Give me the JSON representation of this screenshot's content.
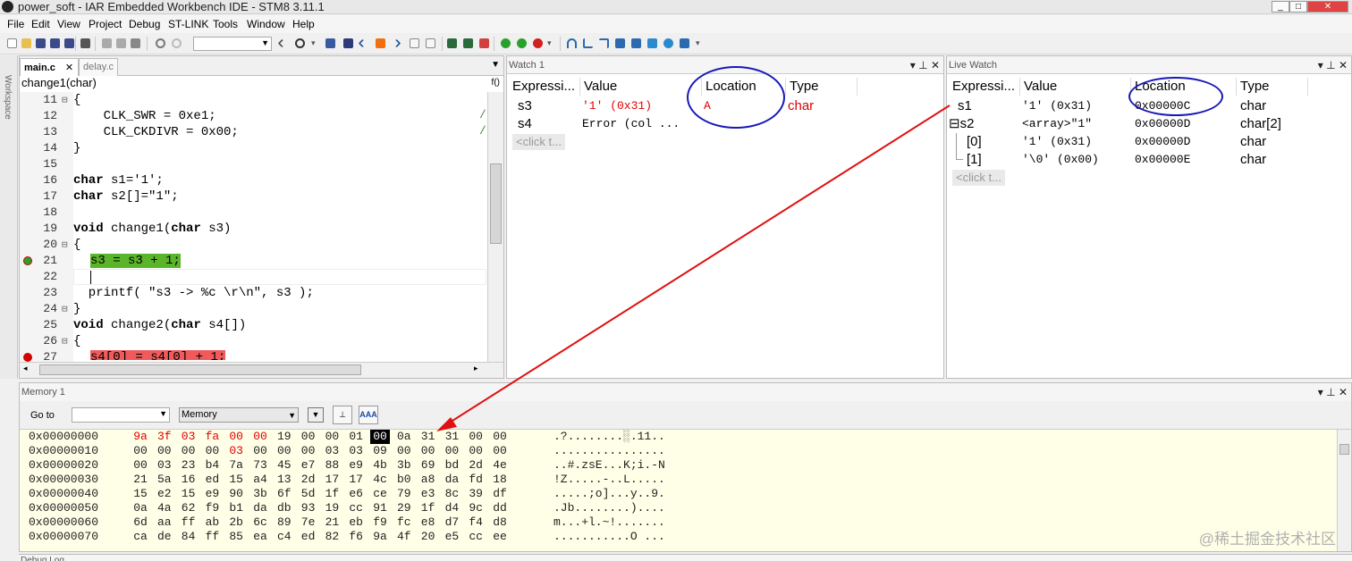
{
  "window": {
    "title": "power_soft - IAR Embedded Workbench IDE - STM8 3.11.1"
  },
  "menu": [
    "File",
    "Edit",
    "View",
    "Project",
    "Debug",
    "ST-LINK",
    "Tools",
    "Window",
    "Help"
  ],
  "workspace_label": "Workspace",
  "editor": {
    "tabs": [
      {
        "label": "main.c",
        "active": true
      },
      {
        "label": "delay.c",
        "active": false
      }
    ],
    "function_bar": "change1(char)",
    "function_icon": "f()",
    "gutter_lines": [
      "11",
      "12",
      "13",
      "14",
      "15",
      "16",
      "17",
      "18",
      "19",
      "20",
      "21",
      "22",
      "23",
      "24",
      "25",
      "26",
      "27"
    ],
    "code": {
      "l11": "{",
      "l12": "    CLK_SWR = 0xe1;",
      "l13": "    CLK_CKDIVR = 0x00;",
      "l14": "}",
      "l16_kw": "char",
      "l16_rest": " s1='1';",
      "l17_kw": "char",
      "l17_rest": " s2[]=\"1\";",
      "l19_kw1": "void",
      "l19_mid": " change1(",
      "l19_kw2": "char",
      "l19_end": " s3)",
      "l20": "{",
      "l21": "s3 = s3 + 1;",
      "l23": "  printf( \"s3 -> %c \\r\\n\", s3 );",
      "l24": "}",
      "l25_kw1": "void",
      "l25_mid": " change2(",
      "l25_kw2": "char",
      "l25_end": " s4[])",
      "l26": "{",
      "l27": "s4[0] = s4[0] + 1;",
      "comment1": "/",
      "comment2": "/"
    }
  },
  "watch1": {
    "title": "Watch 1",
    "columns": [
      "Expressi...",
      "Value",
      "Location",
      "Type"
    ],
    "rows": [
      {
        "expr": "s3",
        "value": "'1' (0x31)",
        "location": "A",
        "type": "char"
      },
      {
        "expr": "s4",
        "value": "Error (col ...",
        "location": "",
        "type": ""
      }
    ],
    "placeholder": "<click t..."
  },
  "livewatch": {
    "title": "Live Watch",
    "columns": [
      "Expressi...",
      "Value",
      "Location",
      "Type"
    ],
    "rows": [
      {
        "expr": "s1",
        "value": "'1' (0x31)",
        "location": "0x00000C",
        "type": "char"
      },
      {
        "expr": "⊟s2",
        "value": "<array>\"1\"",
        "location": "0x00000D",
        "type": "char[2]"
      },
      {
        "expr": "[0]",
        "value": "'1' (0x31)",
        "location": "0x00000D",
        "type": "char"
      },
      {
        "expr": "[1]",
        "value": "'\\0' (0x00)",
        "location": "0x00000E",
        "type": "char"
      }
    ],
    "placeholder": "<click t..."
  },
  "memory": {
    "title": "Memory 1",
    "goto_label": "Go to",
    "zone": "Memory",
    "rows": [
      {
        "addr": "0x00000000",
        "bytes": [
          "9a",
          "3f",
          "03",
          "fa",
          "00",
          "00",
          "19",
          "00",
          "00",
          "01",
          "00",
          "0a",
          "31",
          "31",
          "00",
          "00"
        ],
        "ascii": ".?........░.11.."
      },
      {
        "addr": "0x00000010",
        "bytes": [
          "00",
          "00",
          "00",
          "00",
          "03",
          "00",
          "00",
          "00",
          "03",
          "03",
          "09",
          "00",
          "00",
          "00",
          "00",
          "00"
        ],
        "ascii": "................"
      },
      {
        "addr": "0x00000020",
        "bytes": [
          "00",
          "03",
          "23",
          "b4",
          "7a",
          "73",
          "45",
          "e7",
          "88",
          "e9",
          "4b",
          "3b",
          "69",
          "bd",
          "2d",
          "4e"
        ],
        "ascii": "..#.zsE...K;i.-N"
      },
      {
        "addr": "0x00000030",
        "bytes": [
          "21",
          "5a",
          "16",
          "ed",
          "15",
          "a4",
          "13",
          "2d",
          "17",
          "17",
          "4c",
          "b0",
          "a8",
          "da",
          "fd",
          "18"
        ],
        "ascii": "!Z.....-..L....."
      },
      {
        "addr": "0x00000040",
        "bytes": [
          "15",
          "e2",
          "15",
          "e9",
          "90",
          "3b",
          "6f",
          "5d",
          "1f",
          "e6",
          "ce",
          "79",
          "e3",
          "8c",
          "39",
          "df"
        ],
        "ascii": ".....;o]...y..9."
      },
      {
        "addr": "0x00000050",
        "bytes": [
          "0a",
          "4a",
          "62",
          "f9",
          "b1",
          "da",
          "db",
          "93",
          "19",
          "cc",
          "91",
          "29",
          "1f",
          "d4",
          "9c",
          "dd"
        ],
        "ascii": ".Jb........)...."
      },
      {
        "addr": "0x00000060",
        "bytes": [
          "6d",
          "aa",
          "ff",
          "ab",
          "2b",
          "6c",
          "89",
          "7e",
          "21",
          "eb",
          "f9",
          "fc",
          "e8",
          "d7",
          "f4",
          "d8"
        ],
        "ascii": "m...+l.~!......."
      },
      {
        "addr": "0x00000070",
        "bytes": [
          "ca",
          "de",
          "84",
          "ff",
          "85",
          "ea",
          "c4",
          "ed",
          "82",
          "f6",
          "9a",
          "4f",
          "20",
          "e5",
          "cc",
          "ee"
        ],
        "ascii": "...........O ..."
      }
    ]
  },
  "watermark": "@稀土掘金技术社区",
  "debuglog_title": "Debug Log",
  "colors": {
    "annotation_blue": "#1818b8",
    "annotation_red": "#e01010",
    "error_red": "#e00000",
    "pc_green": "#5ab52a",
    "bp_red": "#f05a5a"
  }
}
